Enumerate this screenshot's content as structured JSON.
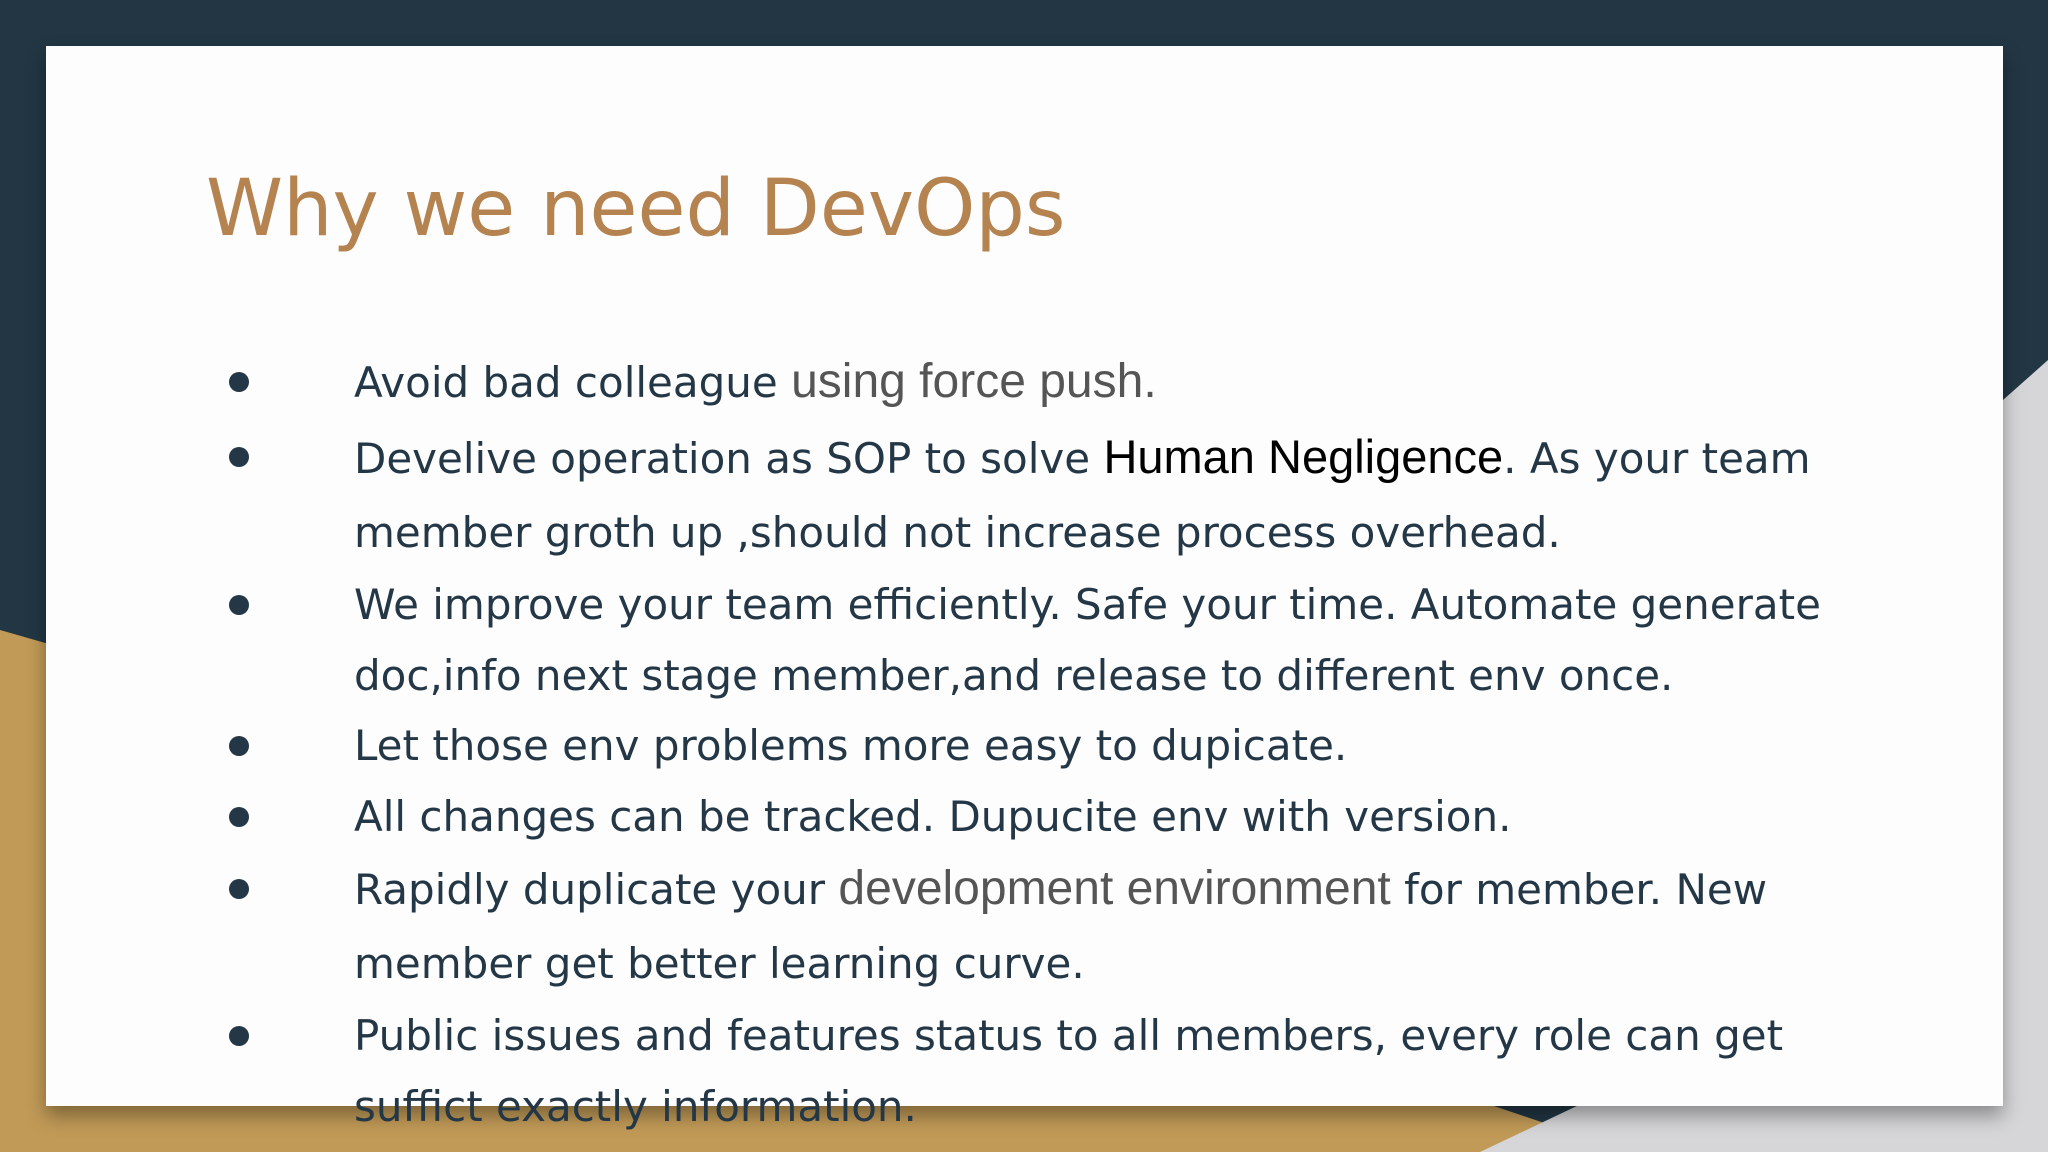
{
  "colors": {
    "frame_navy": "#223644",
    "frame_gold": "#c19a57",
    "frame_gray": "#d6d6d8",
    "title": "#b5834f",
    "body_text": "#243746"
  },
  "slide": {
    "title": "Why we need DevOps",
    "bullets": [
      {
        "segments": [
          {
            "text": "Avoid bad colleague ",
            "style": "plain"
          },
          {
            "text": "using force push.",
            "style": "gray"
          }
        ]
      },
      {
        "segments": [
          {
            "text": "Develive operation as SOP to solve ",
            "style": "plain"
          },
          {
            "text": "Human Negligence",
            "style": "black"
          },
          {
            "text": ". As your team member groth up ,should not increase process overhead.",
            "style": "plain"
          }
        ]
      },
      {
        "segments": [
          {
            "text": "We improve your team efficiently. Safe your time. Automate generate doc,info next stage member,and release to different env once.",
            "style": "plain"
          }
        ]
      },
      {
        "segments": [
          {
            "text": "Let those env problems more easy to dupicate.",
            "style": "plain"
          }
        ]
      },
      {
        "segments": [
          {
            "text": "All changes can be tracked. Dupucite env with version.",
            "style": "plain"
          }
        ]
      },
      {
        "segments": [
          {
            "text": "Rapidly duplicate your ",
            "style": "plain"
          },
          {
            "text": "development environment",
            "style": "gray"
          },
          {
            "text": " for member. New member get better learning curve.",
            "style": "plain"
          }
        ]
      },
      {
        "segments": [
          {
            "text": "Public issues and features status to all members, every role can get suffict exactly information.",
            "style": "plain"
          }
        ]
      }
    ]
  }
}
